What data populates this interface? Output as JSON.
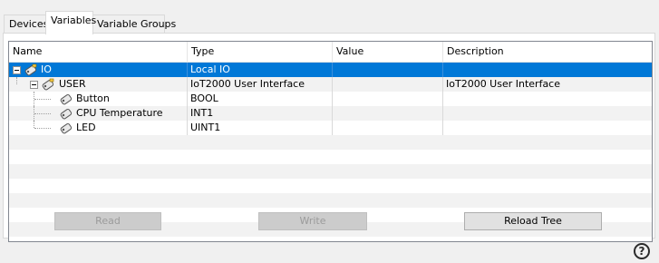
{
  "tabs": [
    {
      "label": "Devices"
    },
    {
      "label": "Variables"
    },
    {
      "label": "Variable Groups"
    }
  ],
  "grid": {
    "columns": [
      "Name",
      "Type",
      "Value",
      "Description"
    ],
    "rows": [
      {
        "name": "IO",
        "type": "Local IO",
        "value": "",
        "description": ""
      },
      {
        "name": "USER",
        "type": "IoT2000 User Interface",
        "value": "",
        "description": "IoT2000 User Interface"
      },
      {
        "name": "Button",
        "type": "BOOL",
        "value": "",
        "description": ""
      },
      {
        "name": "CPU Temperature",
        "type": "INT1",
        "value": "",
        "description": ""
      },
      {
        "name": "LED",
        "type": "UINT1",
        "value": "",
        "description": ""
      }
    ]
  },
  "buttons": {
    "read": "Read",
    "write": "Write",
    "reload": "Reload Tree"
  },
  "help": "?",
  "colors": {
    "selection": "#0078d7",
    "alt_row": "#f2f2f2"
  },
  "icons": [
    "collapse-icon",
    "tag-icon",
    "help-icon"
  ]
}
